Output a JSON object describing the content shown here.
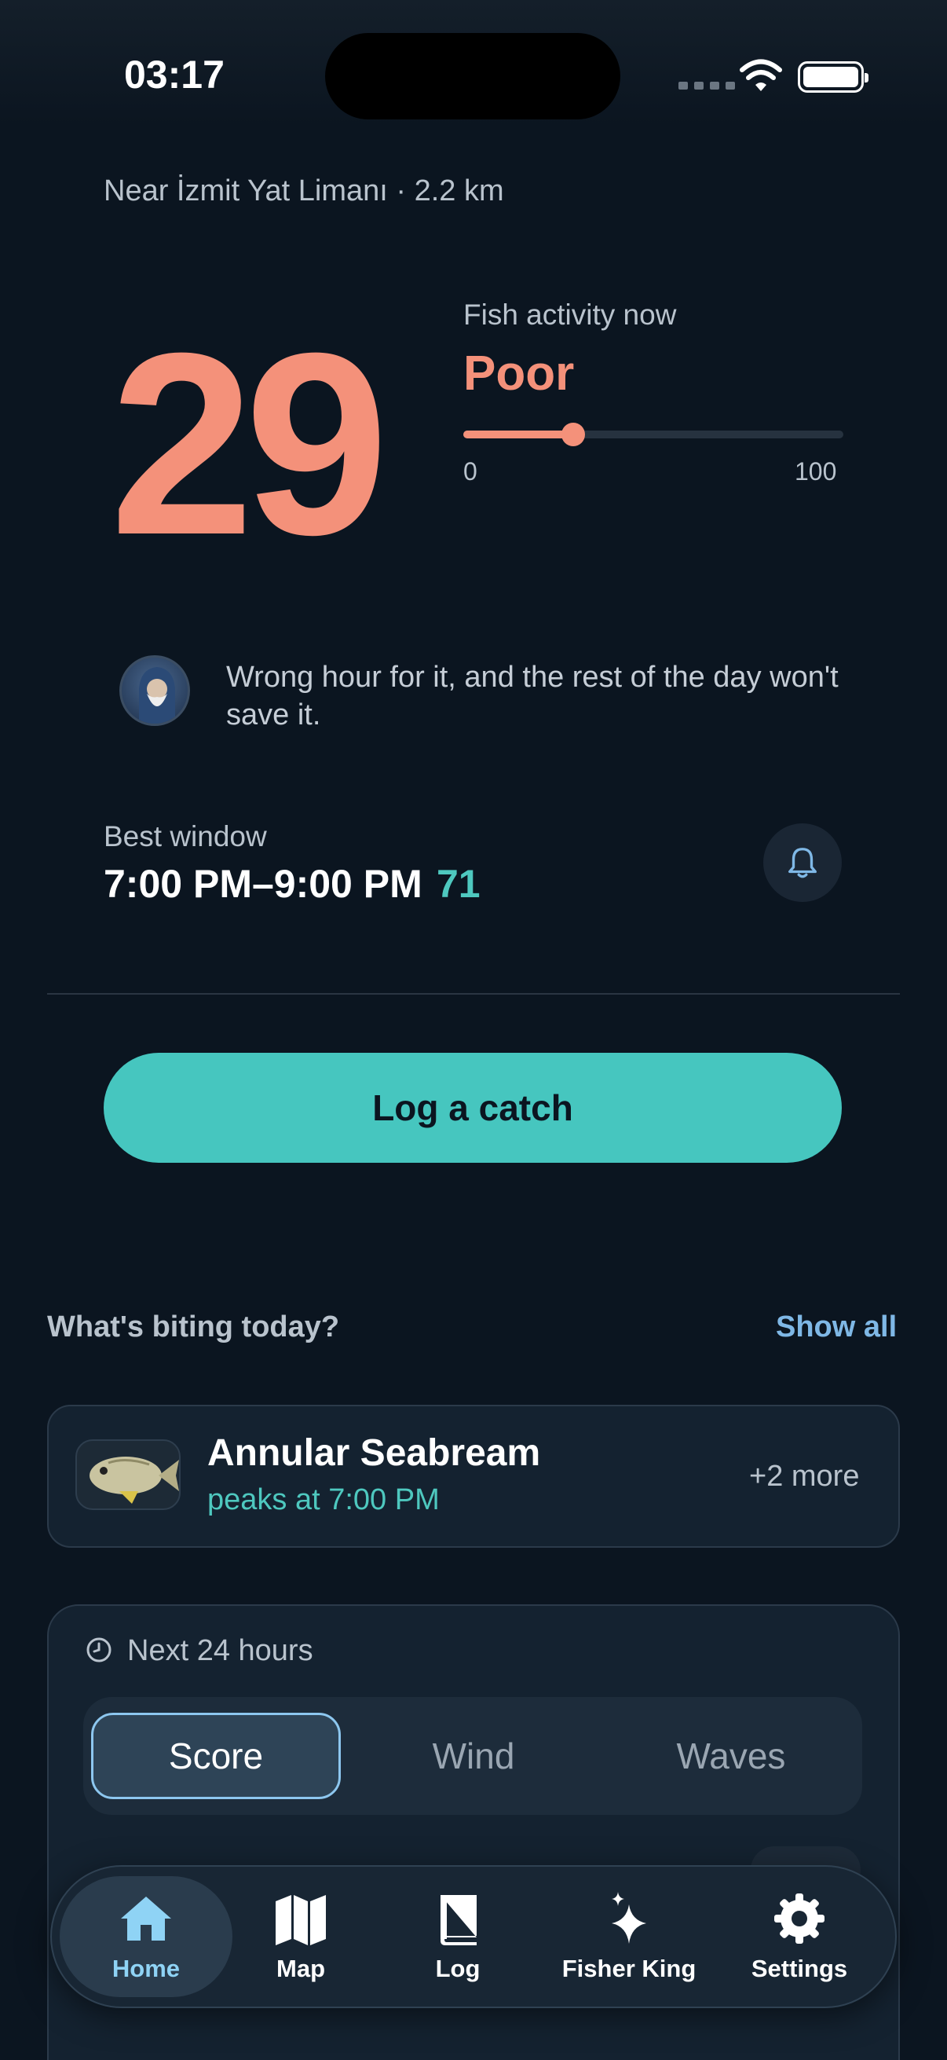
{
  "status": {
    "time": "03:17"
  },
  "location": "Near İzmit Yat Limanı · 2.2 km",
  "activity": {
    "score": "29",
    "score_value": 29,
    "max": 100,
    "label": "Fish activity now",
    "status": "Poor",
    "range_min": "0",
    "range_max": "100",
    "accent": "#f4917a"
  },
  "quote": "Wrong hour for it, and the rest of the day won't save it.",
  "best_window": {
    "label": "Best window",
    "time": "7:00 PM–9:00 PM",
    "score": "71"
  },
  "log_button": "Log a catch",
  "biting": {
    "title": "What's biting today?",
    "show_all": "Show all",
    "fish_name": "Annular Seabream",
    "peak": "peaks at 7:00 PM",
    "more": "+2 more"
  },
  "forecast": {
    "title": "Next 24 hours",
    "tabs": [
      "Score",
      "Wind",
      "Waves"
    ],
    "active_tab": "Score"
  },
  "tabbar": [
    {
      "label": "Home",
      "icon": "home-icon",
      "active": true
    },
    {
      "label": "Map",
      "icon": "map-icon"
    },
    {
      "label": "Log",
      "icon": "book-icon"
    },
    {
      "label": "Fisher King",
      "icon": "sparkles-icon"
    },
    {
      "label": "Settings",
      "icon": "gear-icon"
    }
  ],
  "colors": {
    "background": "#0b1520",
    "teal": "#46c6bf",
    "link": "#7fb8e6"
  }
}
